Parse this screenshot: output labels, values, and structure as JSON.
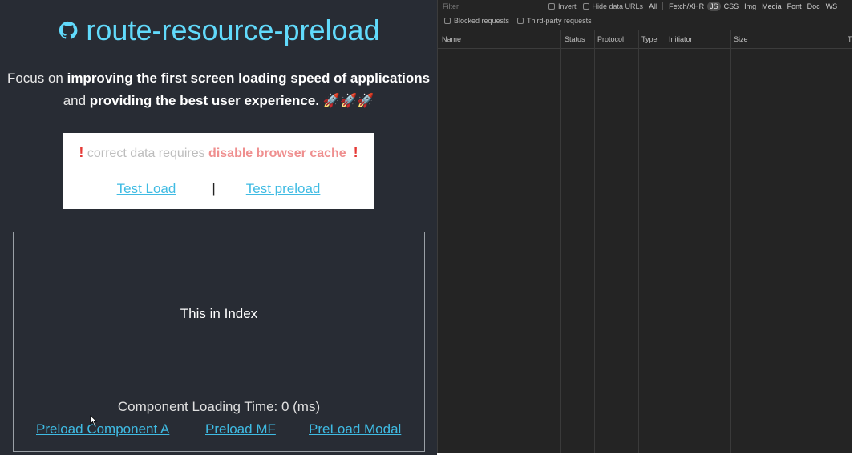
{
  "app": {
    "title": "route-resource-preload",
    "intro": {
      "part1": "Focus on ",
      "bold1": "improving the first screen loading speed of applications",
      "part2": "and ",
      "bold2": "providing the best user experience.",
      "emoji": " 🚀🚀🚀"
    },
    "notice": {
      "bang": "!",
      "text": " correct data requires ",
      "strong": "disable browser cache",
      "links": {
        "test_load": "Test Load",
        "separator": "|",
        "test_preload": "Test preload"
      }
    },
    "demo": {
      "index_text": "This in Index",
      "loading_time": "Component Loading Time: 0 (ms)",
      "preload_component_a": "Preload Component A",
      "preload_mf": "Preload MF",
      "preload_modal": "PreLoad Modal"
    },
    "colors": {
      "background": "#282c34",
      "accent": "#61dafb",
      "link": "#3fbbe3",
      "warning": "#e53935"
    },
    "icons": {
      "title_icon": "github-octocat-icon",
      "cursor": "mouse-pointer-icon"
    }
  },
  "devtools": {
    "filter_placeholder": "Filter",
    "invert": "Invert",
    "hide_data_urls": "Hide data URLs",
    "types": [
      "All",
      "Fetch/XHR",
      "JS",
      "CSS",
      "Img",
      "Media",
      "Font",
      "Doc",
      "WS"
    ],
    "active_type": "JS",
    "blocked_requests": "Blocked requests",
    "third_party_requests": "Third-party requests",
    "columns": [
      "Name",
      "Status",
      "Protocol",
      "Type",
      "Initiator",
      "Size",
      "T"
    ],
    "colors": {
      "background": "#242424"
    }
  }
}
